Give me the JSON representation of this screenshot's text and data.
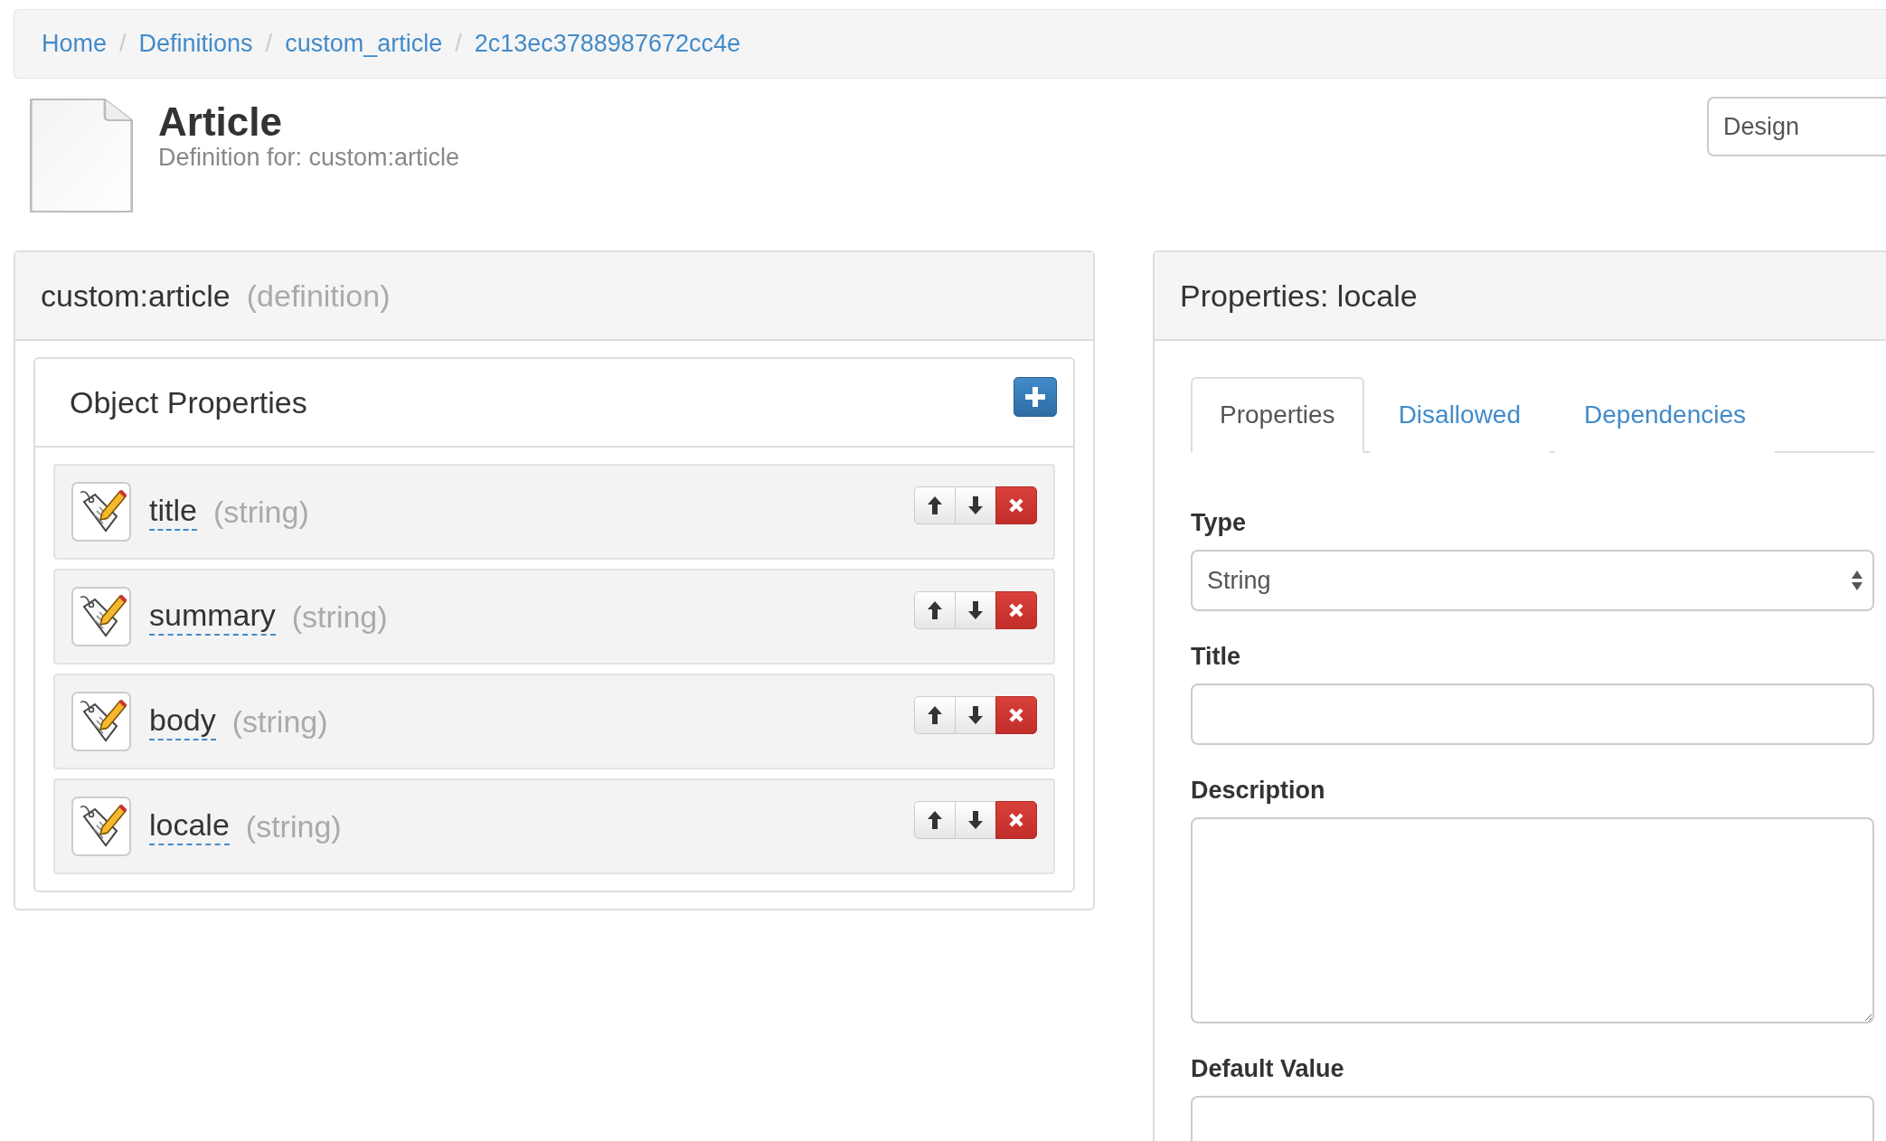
{
  "breadcrumb": [
    {
      "label": "Home"
    },
    {
      "separator": "/",
      "label": "Definitions"
    },
    {
      "separator": "/",
      "label": "custom_article"
    },
    {
      "separator": "/",
      "label": "2c13ec3788987672cc4e"
    }
  ],
  "header": {
    "title": "Article",
    "subtitle": "Definition for: custom:article"
  },
  "view_select": {
    "value": "Design"
  },
  "definition_panel": {
    "title": "custom:article",
    "qualifier": "(definition)",
    "section": {
      "title": "Object Properties",
      "properties": [
        {
          "name": "title",
          "type": "(string)"
        },
        {
          "name": "summary",
          "type": "(string)"
        },
        {
          "name": "body",
          "type": "(string)"
        },
        {
          "name": "locale",
          "type": "(string)"
        }
      ]
    }
  },
  "properties_panel": {
    "title": "Properties: locale",
    "tabs": [
      {
        "label": "Properties",
        "selected": true
      },
      {
        "label": "Disallowed",
        "selected": false
      },
      {
        "label": "Dependencies",
        "selected": false
      }
    ],
    "fields": [
      {
        "kind": "select",
        "label": "Type",
        "value": "String"
      },
      {
        "kind": "input",
        "label": "Title"
      },
      {
        "kind": "textarea",
        "label": "Description"
      },
      {
        "kind": "input",
        "label": "Default Value"
      }
    ]
  }
}
